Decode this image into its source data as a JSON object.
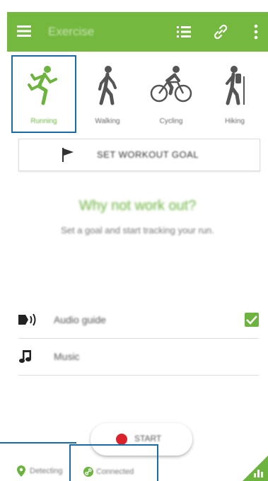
{
  "appbar": {
    "title": "Exercise",
    "color": "#74b83f"
  },
  "activities": [
    {
      "label": "Running",
      "selected": true
    },
    {
      "label": "Walking",
      "selected": false
    },
    {
      "label": "Cycling",
      "selected": false
    },
    {
      "label": "Hiking",
      "selected": false
    }
  ],
  "goal": {
    "label": "SET WORKOUT GOAL"
  },
  "empty": {
    "heading": "Why not work out?",
    "subtext": "Set a goal and start tracking your run."
  },
  "settings": [
    {
      "label": "Audio guide",
      "checked": true
    },
    {
      "label": "Music"
    }
  ],
  "start": {
    "label": "START"
  },
  "status": {
    "location": "Detecting",
    "connection": "Connected"
  },
  "accent": "#6cb33f",
  "callout_color": "#1a6aa5"
}
